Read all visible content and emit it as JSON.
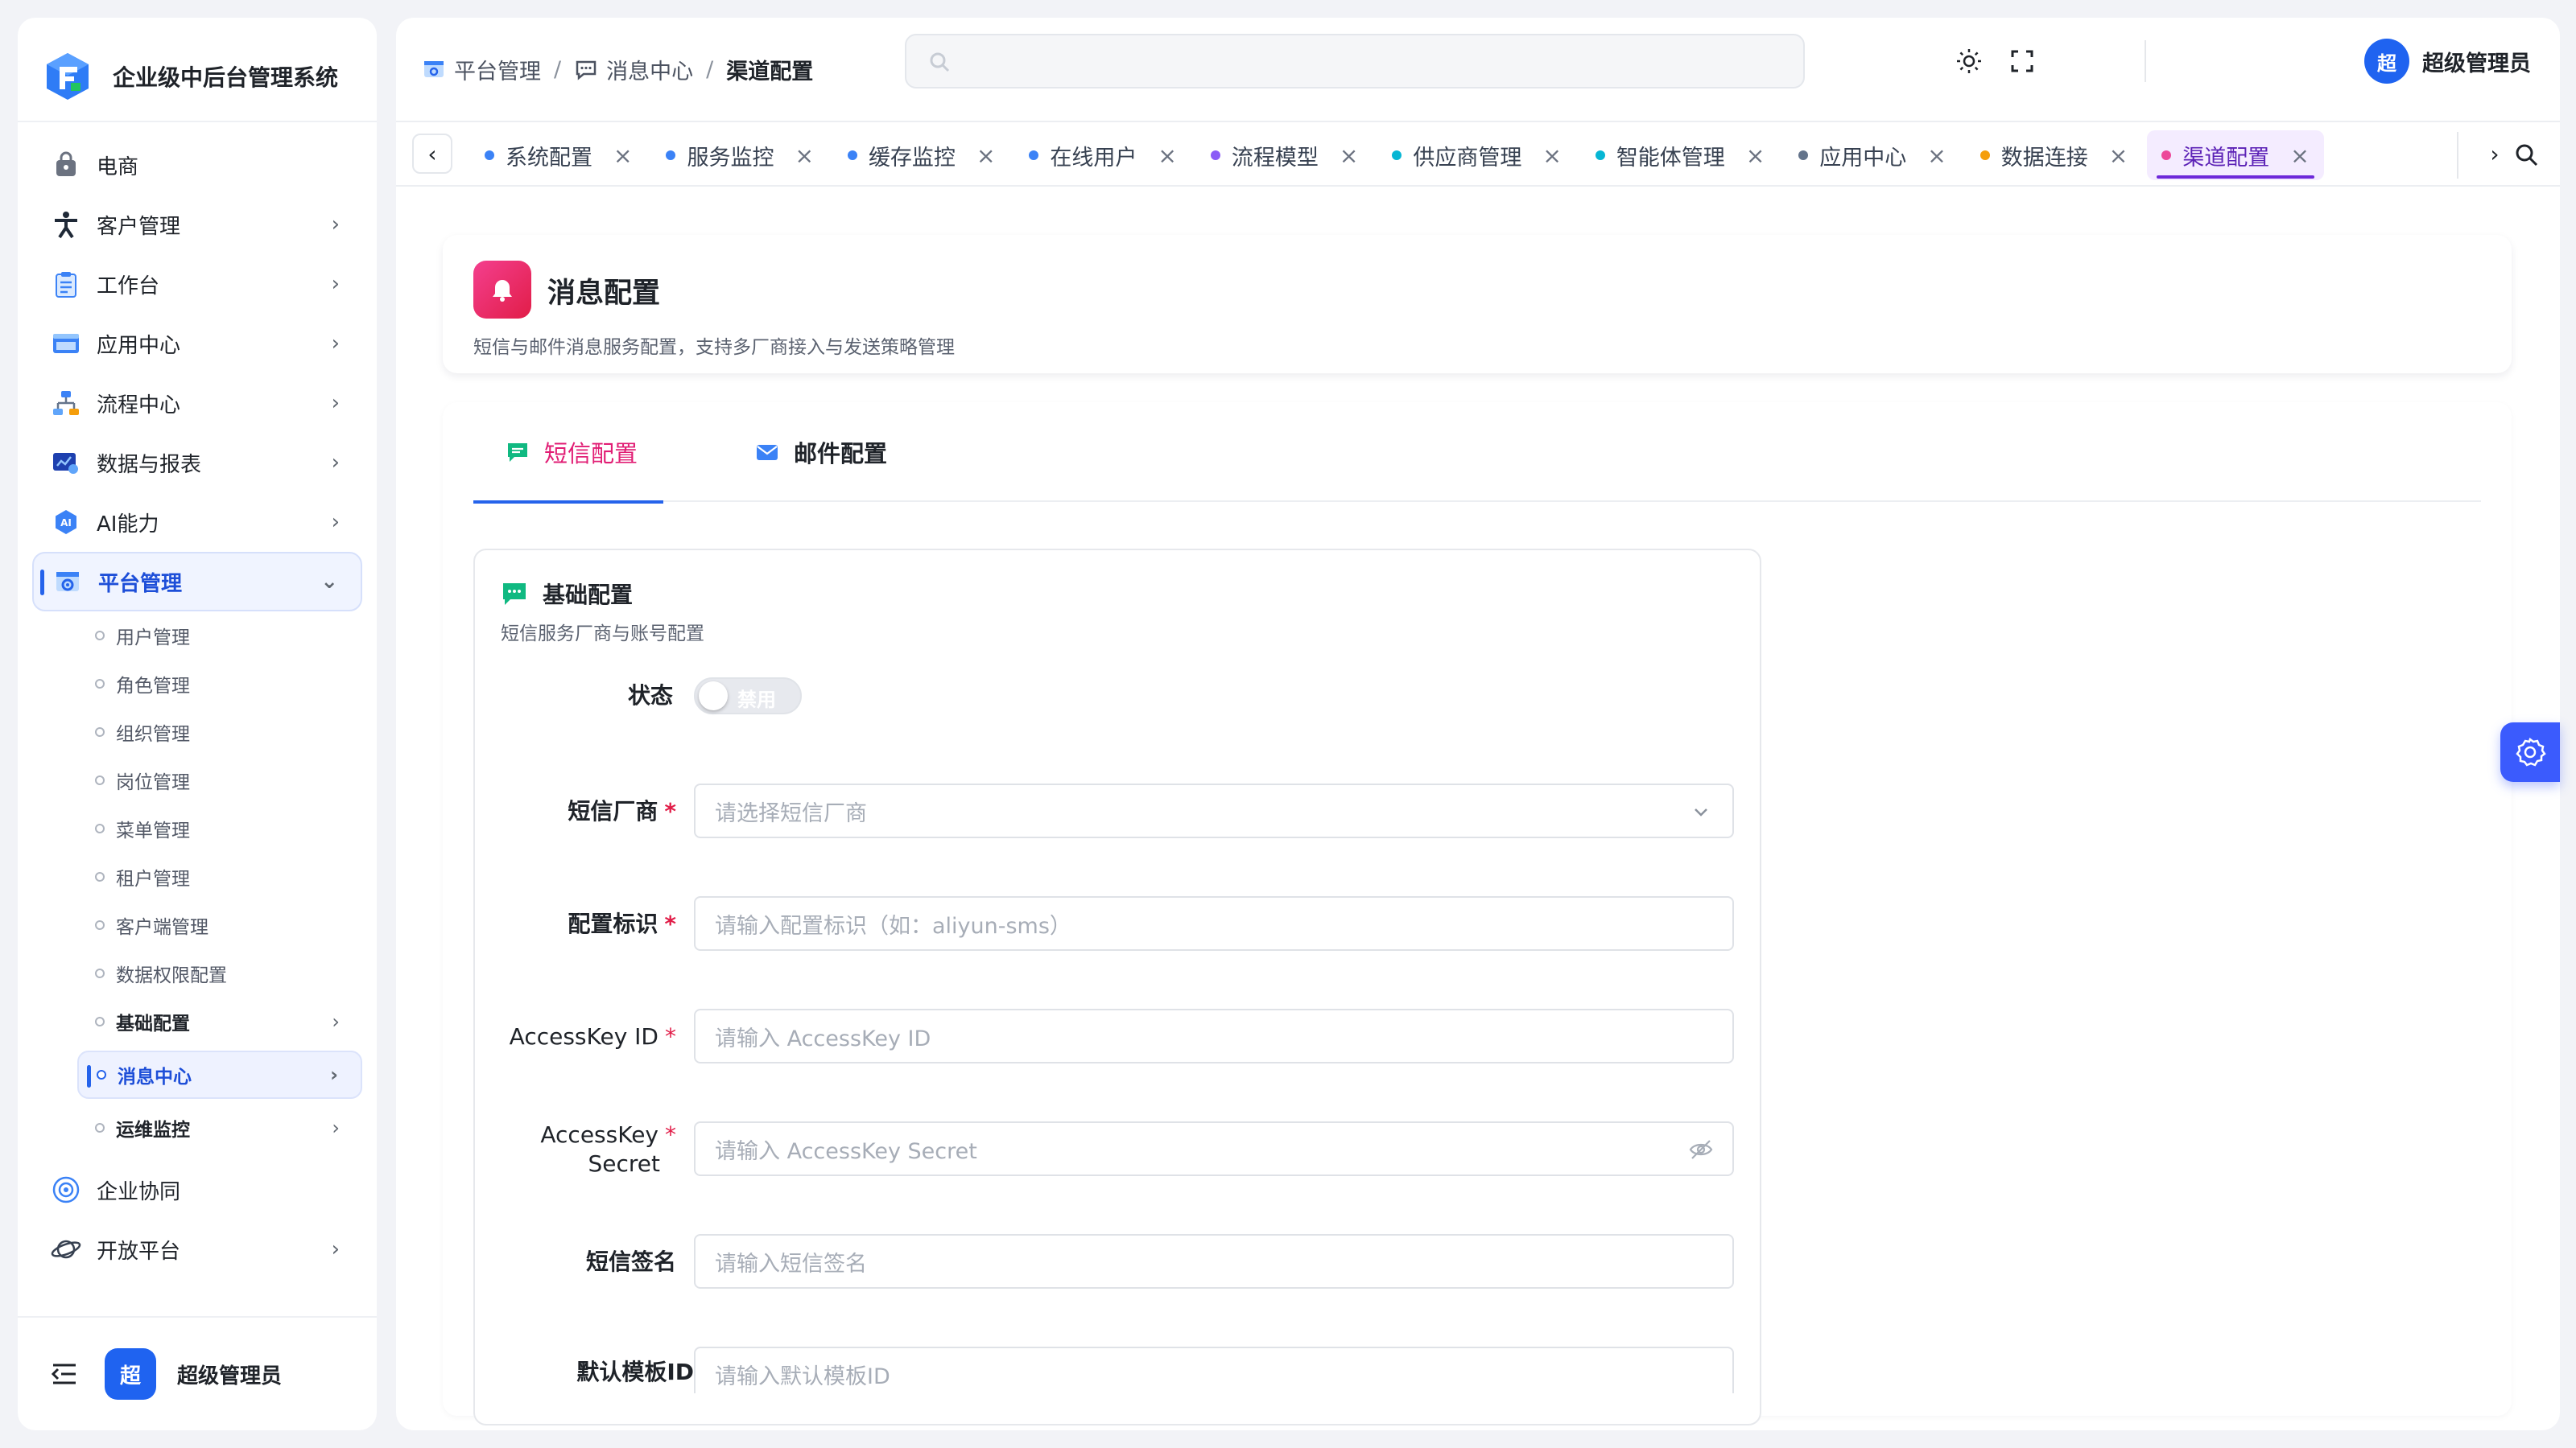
{
  "app": {
    "title": "企业级中后台管理系统"
  },
  "sidebar": {
    "items": [
      {
        "label": "电商",
        "icon": "shopping-bag-icon",
        "chevron": ""
      },
      {
        "label": "客户管理",
        "icon": "person-icon",
        "chevron": "›"
      },
      {
        "label": "工作台",
        "icon": "clipboard-icon",
        "chevron": "›"
      },
      {
        "label": "应用中心",
        "icon": "app-window-icon",
        "chevron": "›"
      },
      {
        "label": "流程中心",
        "icon": "flow-icon",
        "chevron": "›"
      },
      {
        "label": "数据与报表",
        "icon": "report-icon",
        "chevron": "›"
      },
      {
        "label": "AI能力",
        "icon": "ai-icon",
        "chevron": "›"
      },
      {
        "label": "平台管理",
        "icon": "platform-icon",
        "chevron": "⌄"
      }
    ],
    "sub_items": [
      {
        "label": "用户管理"
      },
      {
        "label": "角色管理"
      },
      {
        "label": "组织管理"
      },
      {
        "label": "岗位管理"
      },
      {
        "label": "菜单管理"
      },
      {
        "label": "租户管理"
      },
      {
        "label": "客户端管理"
      },
      {
        "label": "数据权限配置"
      },
      {
        "label": "基础配置",
        "chevron": "›"
      },
      {
        "label": "消息中心",
        "chevron": "›"
      },
      {
        "label": "运维监控",
        "chevron": "›"
      }
    ],
    "bottom_items": [
      {
        "label": "企业协同",
        "icon": "atom-icon",
        "chevron": ""
      },
      {
        "label": "开放平台",
        "icon": "planet-icon",
        "chevron": "›"
      }
    ],
    "footer": {
      "avatar_text": "超",
      "name": "超级管理员"
    }
  },
  "header": {
    "breadcrumb": [
      "平台管理",
      "消息中心",
      "渠道配置"
    ],
    "separator": "/",
    "user": {
      "avatar_text": "超",
      "name": "超级管理员"
    }
  },
  "tabs": {
    "items": [
      {
        "label": "系统配置",
        "color": "#3b82f6"
      },
      {
        "label": "服务监控",
        "color": "#3b82f6"
      },
      {
        "label": "缓存监控",
        "color": "#3b82f6"
      },
      {
        "label": "在线用户",
        "color": "#3b82f6"
      },
      {
        "label": "流程模型",
        "color": "#8b5cf6"
      },
      {
        "label": "供应商管理",
        "color": "#06b6d4"
      },
      {
        "label": "智能体管理",
        "color": "#06b6d4"
      },
      {
        "label": "应用中心",
        "color": "#64748b"
      },
      {
        "label": "数据连接",
        "color": "#f59e0b"
      },
      {
        "label": "渠道配置",
        "color": "#ec4899"
      }
    ],
    "close_glyph": "×",
    "prev": "‹",
    "next": "›"
  },
  "page": {
    "title": "消息配置",
    "description": "短信与邮件消息服务配置，支持多厂商接入与发送策略管理",
    "tabs": [
      {
        "label": "短信配置"
      },
      {
        "label": "邮件配置"
      }
    ],
    "section": {
      "title": "基础配置",
      "description": "短信服务厂商与账号配置"
    },
    "form": {
      "status_label": "状态",
      "status_toggle_text": "禁用",
      "vendor_label": "短信厂商",
      "vendor_placeholder": "请选择短信厂商",
      "config_id_label": "配置标识",
      "config_id_placeholder": "请输入配置标识（如：aliyun-sms）",
      "access_key_id_label": "AccessKey ID",
      "access_key_id_placeholder": "请输入 AccessKey ID",
      "access_key_secret_label_line1": "AccessKey",
      "access_key_secret_label_line2": "Secret",
      "access_key_secret_placeholder": "请输入 AccessKey Secret",
      "signature_label": "短信签名",
      "signature_placeholder": "请输入短信签名",
      "template_label": "默认模板ID",
      "template_placeholder": "请输入默认模板ID",
      "required_mark": "*"
    }
  },
  "colors": {
    "primary": "#2563eb",
    "accent_pink": "#e11d74",
    "active_tab_purple": "#6d28d9",
    "float_button": "#3b5bfd"
  }
}
